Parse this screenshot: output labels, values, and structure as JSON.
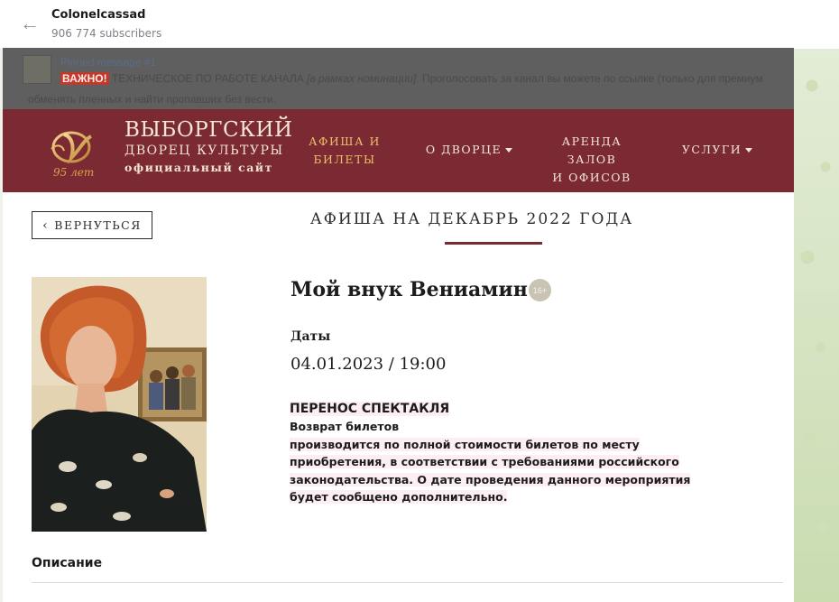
{
  "telegram": {
    "channel_name": "Colonelcassad",
    "subscribers": "906 774 subscribers"
  },
  "pinned": {
    "label": "Pinned message #1",
    "badge": "ВАЖНО!",
    "text_a": " ТЕХНИЧЕСКОЕ  ПО РАБОТЕ КАНАЛА ",
    "text_b": "[в рамках номинации]",
    "text_c": ". Проголосовать за канал вы можете по ссылке (только для премиум",
    "line2": "обменять пленных и найти пропавших без вести."
  },
  "site": {
    "name": "ВЫБОРГСКИЙ",
    "subtitle": "ДВОРЕЦ КУЛЬТУРЫ",
    "tagline": "официальный сайт",
    "logo_years": "95 лет",
    "nav": {
      "afisha_l1": "АФИША И",
      "afisha_l2": "БИЛЕТЫ",
      "dvorets": "О ДВОРЦЕ",
      "arenda_l1": "АРЕНДА ЗАЛОВ",
      "arenda_l2": "И ОФИСОВ",
      "uslugi": "УСЛУГИ"
    },
    "accent_color": "#7b2a33",
    "active_nav_color": "#e9bf6a"
  },
  "page": {
    "back_label": "ВЕРНУТЬСЯ",
    "heading": "АФИША НА ДЕКАБРЬ 2022 ГОДА"
  },
  "event": {
    "title": "Мой внук Вениамин",
    "age_rating": "16+",
    "dates_label": "Даты",
    "date_time": "04.01.2023 / 19:00",
    "notice_title": "ПЕРЕНОС СПЕКТАКЛЯ",
    "notice_lines": [
      "Возврат билетов",
      "производится по полной стоимости билетов по месту",
      "приобретения, в соответствии с требованиями российского",
      "законодательства.  О дате проведения данного мероприятия",
      "будет сообщено дополнительно."
    ],
    "description_label": "Описание"
  }
}
